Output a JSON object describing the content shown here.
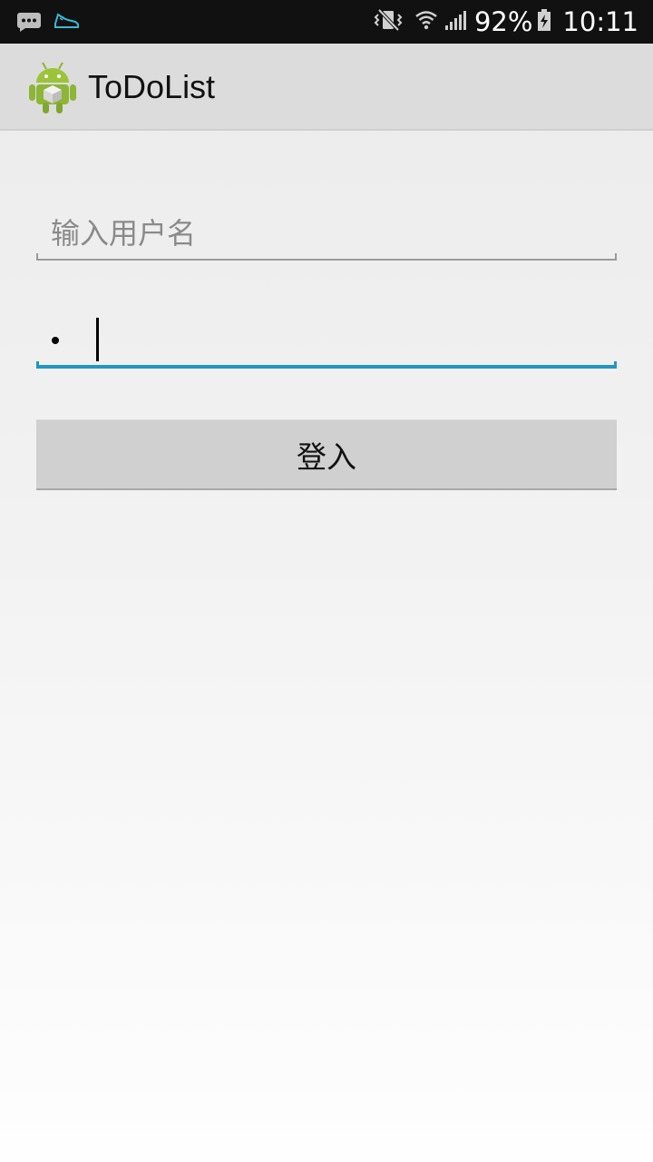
{
  "status_bar": {
    "battery": "92%",
    "time": "10:11",
    "icons": [
      "message-notification-icon",
      "shoe-notification-icon",
      "vibrate-mute-icon",
      "wifi-icon",
      "signal-icon",
      "battery-charging-icon"
    ]
  },
  "app_bar": {
    "title": "ToDoList",
    "icon": "android-app-icon"
  },
  "login_form": {
    "username_placeholder": "输入用户名",
    "username_value": "",
    "password_masked_chars": 1,
    "login_label": "登入"
  },
  "colors": {
    "status_bar_bg": "#111111",
    "action_bar_bg": "#dcdcdc",
    "focus_accent": "#2196c4",
    "button_bg": "#d0d0d0",
    "android_green": "#9bc43b"
  }
}
